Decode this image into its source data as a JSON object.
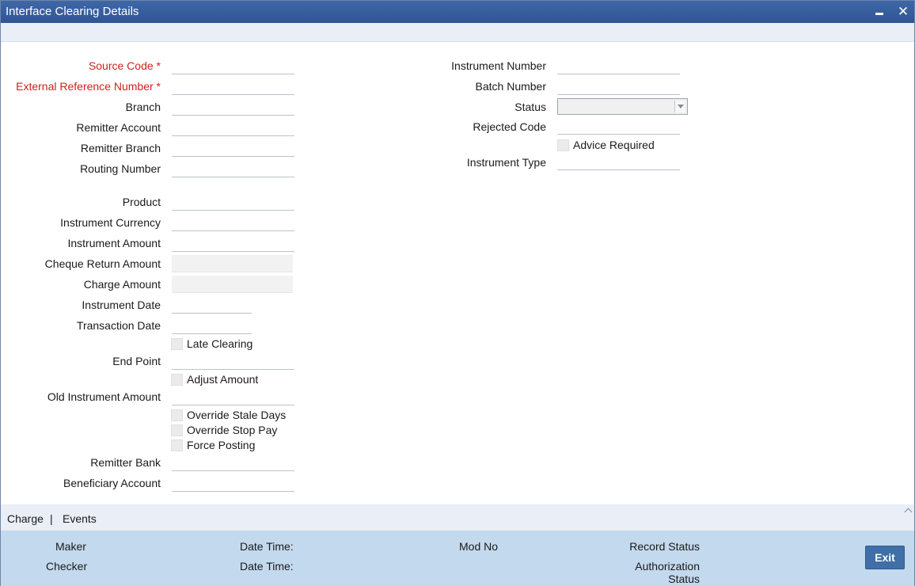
{
  "window": {
    "title": "Interface Clearing Details",
    "minimize_icon": "minimize-icon",
    "close_icon": "close-icon",
    "close_glyph": "✕"
  },
  "left_fields": {
    "source_code": {
      "label": "Source Code",
      "required": "*",
      "value": ""
    },
    "external_reference_number": {
      "label": "External Reference Number",
      "required": "*",
      "value": ""
    },
    "branch": {
      "label": "Branch",
      "value": ""
    },
    "remitter_account": {
      "label": "Remitter Account",
      "value": ""
    },
    "remitter_branch": {
      "label": "Remitter Branch",
      "value": ""
    },
    "routing_number": {
      "label": "Routing Number",
      "value": ""
    },
    "product": {
      "label": "Product",
      "value": ""
    },
    "instrument_currency": {
      "label": "Instrument Currency",
      "value": ""
    },
    "instrument_amount": {
      "label": "Instrument Amount",
      "value": ""
    },
    "cheque_return_amount": {
      "label": "Cheque Return Amount",
      "value": ""
    },
    "charge_amount": {
      "label": "Charge Amount",
      "value": ""
    },
    "instrument_date": {
      "label": "Instrument Date",
      "value": ""
    },
    "transaction_date": {
      "label": "Transaction Date",
      "value": ""
    },
    "late_clearing": {
      "label": "Late Clearing"
    },
    "end_point": {
      "label": "End Point",
      "value": ""
    },
    "adjust_amount": {
      "label": "Adjust Amount"
    },
    "old_instrument_amount": {
      "label": "Old Instrument Amount",
      "value": ""
    },
    "override_stale_days": {
      "label": "Override Stale Days"
    },
    "override_stop_pay": {
      "label": "Override Stop Pay"
    },
    "force_posting": {
      "label": "Force Posting"
    },
    "remitter_bank": {
      "label": "Remitter Bank",
      "value": ""
    },
    "beneficiary_account": {
      "label": "Beneficiary Account",
      "value": ""
    }
  },
  "right_fields": {
    "instrument_number": {
      "label": "Instrument Number",
      "value": ""
    },
    "batch_number": {
      "label": "Batch Number",
      "value": ""
    },
    "status": {
      "label": "Status",
      "selected": ""
    },
    "rejected_code": {
      "label": "Rejected Code",
      "value": ""
    },
    "advice_required": {
      "label": "Advice Required"
    },
    "instrument_type": {
      "label": "Instrument Type",
      "value": ""
    }
  },
  "tabs": {
    "charge": "Charge",
    "separator": "|",
    "events": "Events"
  },
  "footer": {
    "maker": "Maker",
    "checker": "Checker",
    "date_time_1": "Date Time:",
    "date_time_2": "Date Time:",
    "mod_no": "Mod No",
    "record_status": "Record Status",
    "authorization": "Authorization",
    "authorization_status": "Status",
    "exit": "Exit"
  },
  "colors": {
    "title_bar": "#3f67a8",
    "required_label": "#d0201b",
    "footer_bg": "#c3d9ee",
    "exit_button": "#3f6fa6"
  }
}
